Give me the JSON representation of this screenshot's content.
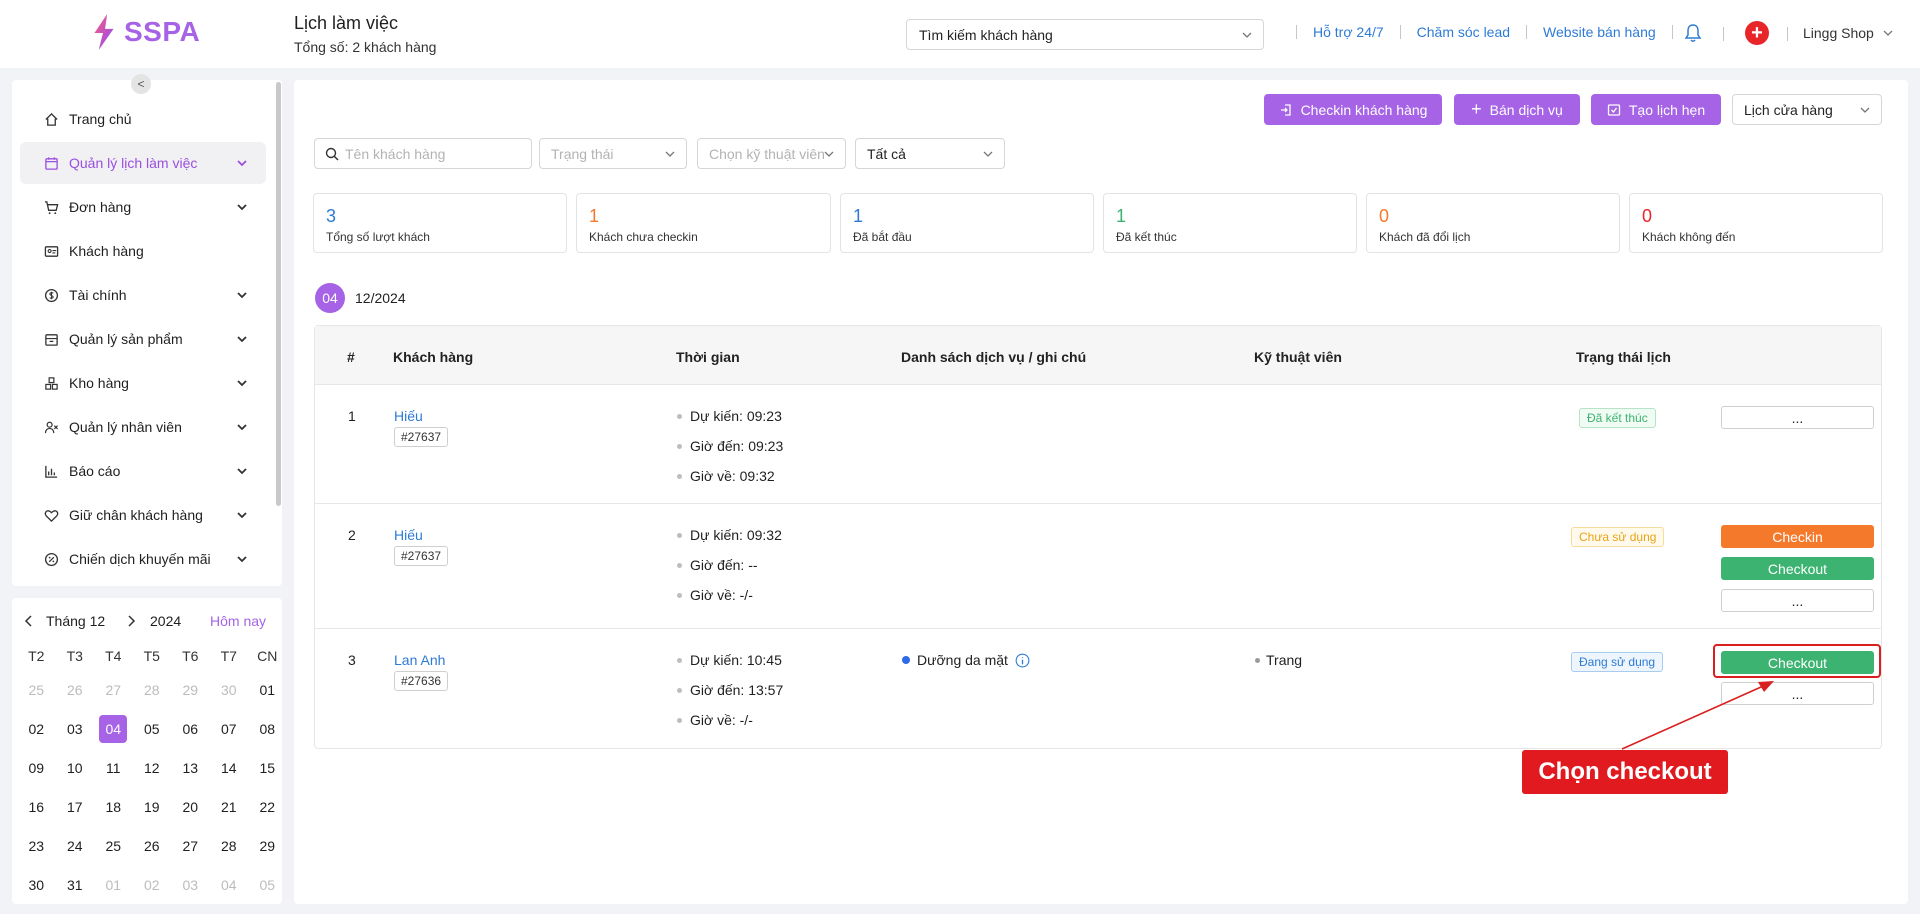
{
  "header": {
    "brand": "SSPA",
    "title": "Lịch làm việc",
    "subtitle": "Tổng số: 2 khách hàng",
    "search_label": "Tìm kiếm khách hàng",
    "links": [
      "Hỗ trợ 24/7",
      "Chăm sóc lead",
      "Website bán hàng"
    ],
    "shop_name": "Lingg Shop"
  },
  "sidebar": {
    "items": [
      {
        "label": "Trang chủ",
        "icon": "home-icon"
      },
      {
        "label": "Quản lý lịch làm việc",
        "icon": "calendar-icon"
      },
      {
        "label": "Đơn hàng",
        "icon": "cart-icon"
      },
      {
        "label": "Khách hàng",
        "icon": "id-card-icon"
      },
      {
        "label": "Tài chính",
        "icon": "dollar-icon"
      },
      {
        "label": "Quản lý sản phẩm",
        "icon": "box-icon"
      },
      {
        "label": "Kho hàng",
        "icon": "warehouse-icon"
      },
      {
        "label": "Quản lý nhân viên",
        "icon": "staff-icon"
      },
      {
        "label": "Báo cáo",
        "icon": "chart-icon"
      },
      {
        "label": "Giữ chân khách hàng",
        "icon": "heart-icon"
      },
      {
        "label": "Chiến dịch khuyến mãi",
        "icon": "discount-icon"
      }
    ]
  },
  "calendar": {
    "month": "Tháng 12",
    "year": "2024",
    "today": "Hôm nay",
    "weekdays": [
      "T2",
      "T3",
      "T4",
      "T5",
      "T6",
      "T7",
      "CN"
    ],
    "rows": [
      [
        "25",
        "26",
        "27",
        "28",
        "29",
        "30",
        "01"
      ],
      [
        "02",
        "03",
        "04",
        "05",
        "06",
        "07",
        "08"
      ],
      [
        "09",
        "10",
        "11",
        "12",
        "13",
        "14",
        "15"
      ],
      [
        "16",
        "17",
        "18",
        "19",
        "20",
        "21",
        "22"
      ],
      [
        "23",
        "24",
        "25",
        "26",
        "27",
        "28",
        "29"
      ],
      [
        "30",
        "31",
        "01",
        "02",
        "03",
        "04",
        "05"
      ]
    ]
  },
  "toolbar": {
    "checkin_label": "Checkin khách hàng",
    "sell_label": "Bán dịch vụ",
    "create_label": "Tạo lịch hẹn",
    "view_select": "Lịch cửa hàng"
  },
  "filters": {
    "name_placeholder": "Tên khách hàng",
    "status_placeholder": "Trạng thái",
    "tech_placeholder": "Chọn kỹ thuật viên",
    "all": "Tất cả"
  },
  "stats": [
    {
      "value": "3",
      "label": "Tổng số lượt khách",
      "color": "#2e7bd6"
    },
    {
      "value": "1",
      "label": "Khách chưa checkin",
      "color": "#f5792a"
    },
    {
      "value": "1",
      "label": "Đã bắt đầu",
      "color": "#2e7bd6"
    },
    {
      "value": "1",
      "label": "Đã kết thúc",
      "color": "#3cb371"
    },
    {
      "value": "0",
      "label": "Khách đã đổi lịch",
      "color": "#f5792a"
    },
    {
      "value": "0",
      "label": "Khách không đến",
      "color": "#e8262a"
    }
  ],
  "date_group": {
    "day": "04",
    "month": "12/2024"
  },
  "table": {
    "headers": [
      "#",
      "Khách hàng",
      "Thời gian",
      "Danh sách dịch vụ / ghi chú",
      "Kỹ thuật viên",
      "Trạng thái lịch"
    ],
    "rows": [
      {
        "idx": "1",
        "name": "Hiếu",
        "code": "#27637",
        "expected": "Dự kiến:  09:23",
        "arrive": "Giờ đến:  09:23",
        "leave": "Giờ về:  09:32",
        "service": "",
        "tech": "",
        "status": "Đã kết thúc",
        "more": "..."
      },
      {
        "idx": "2",
        "name": "Hiếu",
        "code": "#27637",
        "expected": "Dự kiến:  09:32",
        "arrive": "Giờ đến:  --",
        "leave": "Giờ về:  -/-",
        "service": "",
        "tech": "",
        "status": "Chưa sử dụng",
        "checkin": "Checkin",
        "checkout": "Checkout",
        "more": "..."
      },
      {
        "idx": "3",
        "name": "Lan Anh",
        "code": "#27636",
        "expected": "Dự kiến:  10:45",
        "arrive": "Giờ đến:  13:57",
        "leave": "Giờ về:  -/-",
        "service": "Dưỡng da mặt",
        "tech": "Trang",
        "status": "Đang sử dụng",
        "checkout": "Checkout",
        "more": "..."
      }
    ]
  },
  "annotation": {
    "callout": "Chọn checkout"
  },
  "colors": {
    "brand": "#a663e6",
    "link": "#2e7bd6",
    "orange": "#f5792a",
    "green": "#3cb371",
    "red": "#e01a1f"
  }
}
